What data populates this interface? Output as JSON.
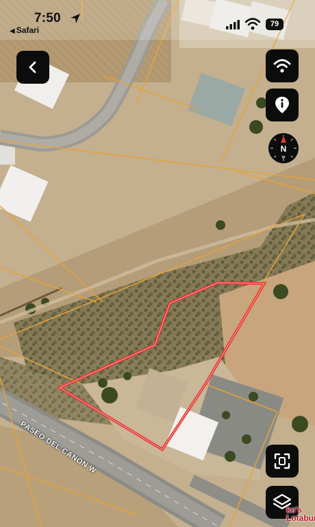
{
  "status_bar": {
    "time": "7:50",
    "back_app": "Safari",
    "battery": "79"
  },
  "map": {
    "road_label": "PASEO DEL CANON W",
    "business_label_line1": "ke's",
    "business_label_line2": "Lotaburg",
    "colors": {
      "parcel_outline": "#e83030",
      "parcel_lines": "#e5a33a",
      "button_bg": "#0c0c0c",
      "compass_north": "#e53935"
    }
  },
  "controls": {
    "compass_letter": "N",
    "icons": [
      "back-arrow-icon",
      "wifi-icon",
      "info-icon",
      "compass-icon",
      "scan-frame-icon",
      "layers-icon"
    ]
  }
}
